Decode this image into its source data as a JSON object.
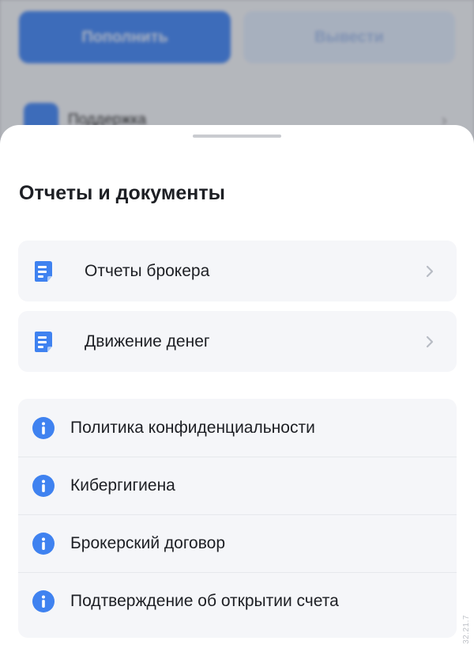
{
  "background": {
    "deposit_label": "Пополнить",
    "withdraw_label": "Вывести",
    "support_label": "Поддержка"
  },
  "sheet": {
    "title": "Отчеты и документы",
    "reports": [
      {
        "label": "Отчеты брокера",
        "icon": "document-icon"
      },
      {
        "label": "Движение денег",
        "icon": "document-icon"
      }
    ],
    "documents": [
      {
        "label": "Политика конфиденциальности",
        "icon": "info-icon"
      },
      {
        "label": "Кибергигиена",
        "icon": "info-icon"
      },
      {
        "label": "Брокерский договор",
        "icon": "info-icon"
      },
      {
        "label": "Подтверждение об открытии счета",
        "icon": "info-icon"
      }
    ]
  },
  "version": "32.21.7",
  "colors": {
    "accent": "#3f82f0",
    "card_bg": "#f5f6f9",
    "text": "#1d1f24",
    "chevron": "#b8bcc4"
  }
}
